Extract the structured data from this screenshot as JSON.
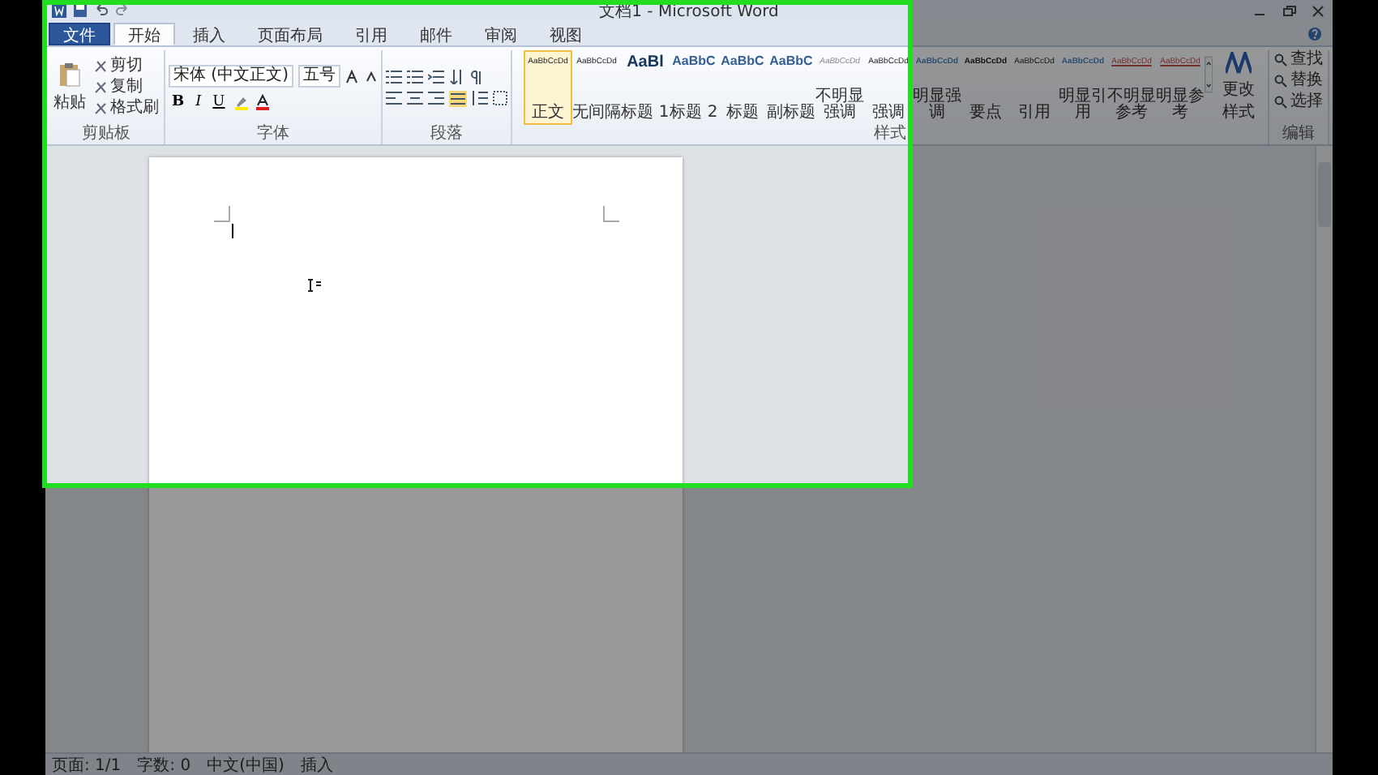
{
  "window": {
    "title": "文档1 - Microsoft Word"
  },
  "tabs": [
    {
      "label": "文件",
      "kind": "file",
      "selected": false
    },
    {
      "label": "开始",
      "kind": "tab",
      "selected": true
    },
    {
      "label": "插入",
      "kind": "tab",
      "selected": false
    },
    {
      "label": "页面布局",
      "kind": "tab",
      "selected": false
    },
    {
      "label": "引用",
      "kind": "tab",
      "selected": false
    },
    {
      "label": "邮件",
      "kind": "tab",
      "selected": false
    },
    {
      "label": "审阅",
      "kind": "tab",
      "selected": false
    },
    {
      "label": "视图",
      "kind": "tab",
      "selected": false
    }
  ],
  "ribbon": {
    "clipboard": {
      "paste": "粘贴",
      "items": [
        "剪切",
        "复制",
        "格式刷"
      ],
      "group": "剪贴板"
    },
    "font": {
      "family": "宋体 (中文正文)",
      "size": "五号",
      "format_buttons": [
        "B",
        "I",
        "U"
      ],
      "group": "字体"
    },
    "paragraph": {
      "group": "段落"
    },
    "styles": {
      "items": [
        {
          "preview": "AaBbCcDd",
          "name": "正文",
          "kind": "plain",
          "selected": true
        },
        {
          "preview": "AaBbCcDd",
          "name": "无间隔",
          "kind": "plain",
          "selected": false
        },
        {
          "preview": "AaBl",
          "name": "标题 1",
          "kind": "title",
          "selected": false
        },
        {
          "preview": "AaBbC",
          "name": "标题 2",
          "kind": "heading",
          "selected": false
        },
        {
          "preview": "AaBbC",
          "name": "标题",
          "kind": "heading",
          "selected": false
        },
        {
          "preview": "AaBbC",
          "name": "副标题",
          "kind": "heading",
          "selected": false
        },
        {
          "preview": "AaBbCcDd",
          "name": "不明显强调",
          "kind": "subtle",
          "selected": false
        },
        {
          "preview": "AaBbCcDd",
          "name": "强调",
          "kind": "plain",
          "selected": false
        },
        {
          "preview": "AaBbCcDd",
          "name": "明显强调",
          "kind": "accent",
          "selected": false
        },
        {
          "preview": "AaBbCcDd",
          "name": "要点",
          "kind": "strong",
          "selected": false
        },
        {
          "preview": "AaBbCcDd",
          "name": "引用",
          "kind": "plain",
          "selected": false
        },
        {
          "preview": "AaBbCcDd",
          "name": "明显引用",
          "kind": "accent",
          "selected": false
        },
        {
          "preview": "AaBbCcDd",
          "name": "不明显参考",
          "kind": "reference",
          "selected": false
        },
        {
          "preview": "AaBbCcDd",
          "name": "明显参考",
          "kind": "reference",
          "selected": false
        }
      ],
      "change": "更改样式",
      "group": "样式"
    },
    "editing": {
      "items": [
        "查找",
        "替换",
        "选择"
      ],
      "group": "编辑"
    }
  },
  "status_bar": [
    "页面: 1/1",
    "字数: 0",
    "中文(中国)",
    "插入"
  ]
}
